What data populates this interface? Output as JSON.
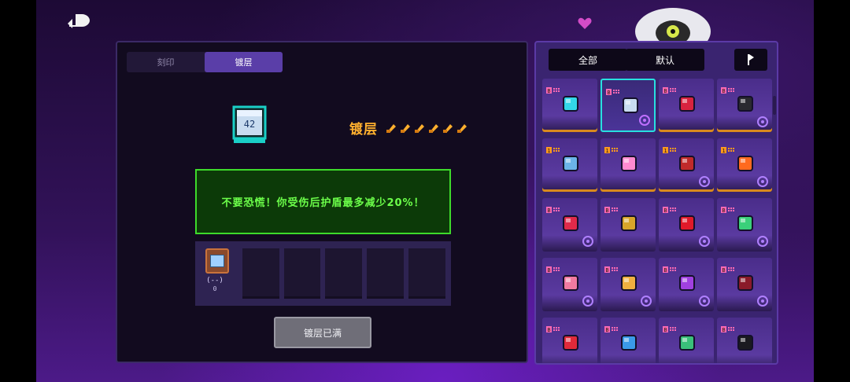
{
  "header": {
    "back_icon": "back-arrow-icon"
  },
  "left_panel": {
    "tabs": [
      {
        "label": "刻印",
        "active": false
      },
      {
        "label": "镀层",
        "active": true
      }
    ],
    "item_icon": "chip-42-icon",
    "item_chip_text": "42",
    "plating_label": "镀层",
    "plating_level": 6,
    "message": "不要恐慌！你受伤后护盾最多减少20%！",
    "slots": [
      {
        "filled": true,
        "label": "(--)",
        "count": "0"
      },
      {
        "filled": false
      },
      {
        "filled": false
      },
      {
        "filled": false
      },
      {
        "filled": false
      },
      {
        "filled": false
      }
    ],
    "cleared_button": "镀层已满"
  },
  "right_panel": {
    "filters": {
      "all_label": "全部",
      "default_label": "默认",
      "sort_icon": "sort-flag-icon"
    },
    "items": [
      {
        "badge": "B",
        "icon": "cyan-orb-icon",
        "highlight": "orange"
      },
      {
        "badge": "B",
        "icon": "chip-42-icon",
        "highlight": "selected",
        "sub": "ankh-icon"
      },
      {
        "badge": "B",
        "icon": "crimson-heart-icon",
        "highlight": "orange"
      },
      {
        "badge": "B",
        "icon": "black-orbs-icon",
        "highlight": "orange",
        "sub": "swirl-icon"
      },
      {
        "badge": "1",
        "icon": "ribcage-icon",
        "highlight": "orange"
      },
      {
        "badge": "1",
        "icon": "cotton-candy-icon",
        "highlight": "orange"
      },
      {
        "badge": "1",
        "icon": "joystick-icon",
        "highlight": "orange",
        "sub": "gear-icon"
      },
      {
        "badge": "1",
        "icon": "fire-flower-icon",
        "highlight": "orange",
        "sub": "gear-icon"
      },
      {
        "badge": "B",
        "icon": "lipstick-icon",
        "highlight": "none",
        "sub": "t-icon"
      },
      {
        "badge": "B",
        "icon": "battery-icon",
        "highlight": "none"
      },
      {
        "badge": "B",
        "icon": "red-feather-icon",
        "highlight": "none",
        "sub": "swirl-icon"
      },
      {
        "badge": "B",
        "icon": "crystal-star-icon",
        "highlight": "none",
        "sub": "star-icon"
      },
      {
        "badge": "B",
        "icon": "pink-frog-icon",
        "highlight": "none",
        "sub": "skull-icon"
      },
      {
        "badge": "B",
        "icon": "hamster-icon",
        "highlight": "none",
        "sub": "shield-icon"
      },
      {
        "badge": "B",
        "icon": "purple-spear-icon",
        "highlight": "none",
        "sub": "shield-icon"
      },
      {
        "badge": "B",
        "icon": "dark-demon-icon",
        "highlight": "none",
        "sub": "shield-icon"
      },
      {
        "badge": "B",
        "icon": "red-crystal-icon",
        "highlight": "none"
      },
      {
        "badge": "B",
        "icon": "blue-disc-icon",
        "highlight": "none"
      },
      {
        "badge": "B",
        "icon": "green-card-icon",
        "highlight": "none"
      },
      {
        "badge": "B",
        "icon": "dark-helmet-icon",
        "highlight": "none"
      }
    ]
  },
  "colors": {
    "accent_orange": "#ffb02e",
    "message_green": "#6cff4a",
    "selected_cyan": "#28e0e0",
    "panel_purple": "#3a2470"
  }
}
